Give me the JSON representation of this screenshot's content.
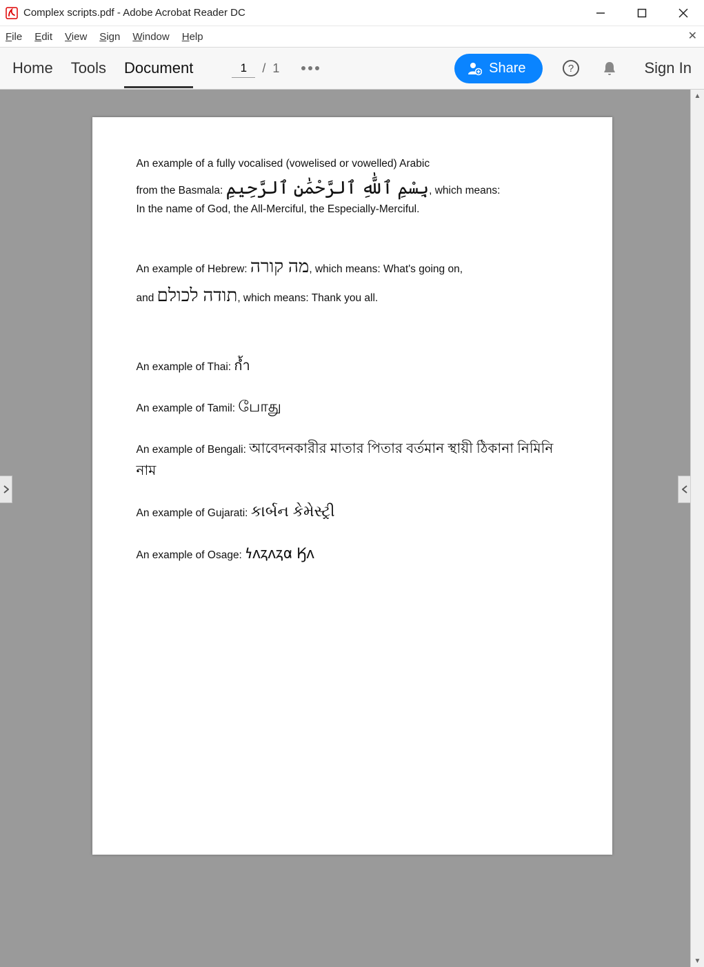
{
  "window": {
    "title": "Complex scripts.pdf - Adobe Acrobat Reader DC"
  },
  "menubar": {
    "items": [
      {
        "letter": "F",
        "rest": "ile"
      },
      {
        "letter": "E",
        "rest": "dit"
      },
      {
        "letter": "V",
        "rest": "iew"
      },
      {
        "letter": "S",
        "rest": "ign"
      },
      {
        "letter": "W",
        "rest": "indow"
      },
      {
        "letter": "H",
        "rest": "elp"
      }
    ]
  },
  "toolbar": {
    "tabs": {
      "home": "Home",
      "tools": "Tools",
      "document": "Document"
    },
    "page_current": "1",
    "page_sep": "/",
    "page_total": "1",
    "share_label": "Share",
    "signin_label": "Sign In"
  },
  "document": {
    "arabic": {
      "line1": "An example of a fully vocalised (vowelised or vowelled) Arabic",
      "line2_pre": "from the Basmala: ",
      "line2_script": "بِسْمِ ٱللَّٰهِ ٱلرَّحْمَٰنِ ٱلرَّحِيمِ",
      "line2_post": ", which means:",
      "line3": "In the name of God, the All-Merciful, the Especially-Merciful."
    },
    "hebrew": {
      "line1_pre": "An example of Hebrew: ",
      "line1_script": "מה קורה",
      "line1_post": ", which means: What's going on,",
      "line2_pre": "and ",
      "line2_script": "תודה לכולם",
      "line2_post": ", which means: Thank you all."
    },
    "thai": {
      "pre": "An example of Thai: ",
      "script": "ก้ำ"
    },
    "tamil": {
      "pre": "An example of Tamil: ",
      "script": "போது"
    },
    "bengali": {
      "pre": "An example of Bengali: ",
      "script": "আবেদনকারীর মাতার পিতার বর্তমান স্থায়ী ঠিকানা নিমিনি নাম"
    },
    "gujarati": {
      "pre": "An example of Gujarati: ",
      "script": "કાર્બન કેમેસ્ટ્રી"
    },
    "osage": {
      "pre": "An example of Osage: ",
      "script": "𐓏𐓘𐓻𐓘𐓻𐓟 𐒼𐓘"
    }
  }
}
